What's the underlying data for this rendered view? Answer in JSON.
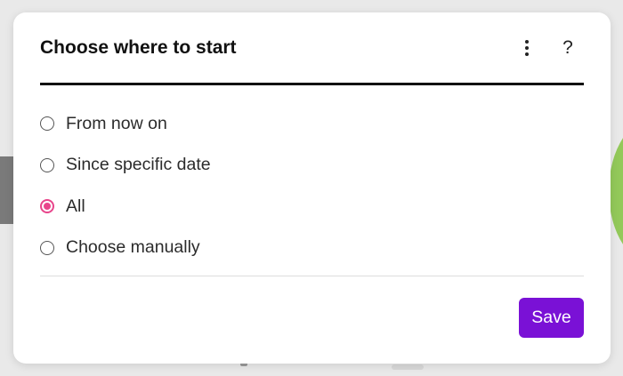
{
  "dialog": {
    "title": "Choose where to start",
    "menu_icon": "kebab-vertical-icon",
    "help_label": "?",
    "save_label": "Save"
  },
  "options": [
    {
      "label": "From now on",
      "checked": false
    },
    {
      "label": "Since specific date",
      "checked": false
    },
    {
      "label": "All",
      "checked": true
    },
    {
      "label": "Choose manually",
      "checked": false
    }
  ],
  "colors": {
    "accent_radio": "#e8458b",
    "save_button": "#7a11d6",
    "header_rule": "#111111",
    "backdrop": "#e9e9e9",
    "background_green": "#93c95a",
    "background_gray": "#7a7a7a"
  }
}
